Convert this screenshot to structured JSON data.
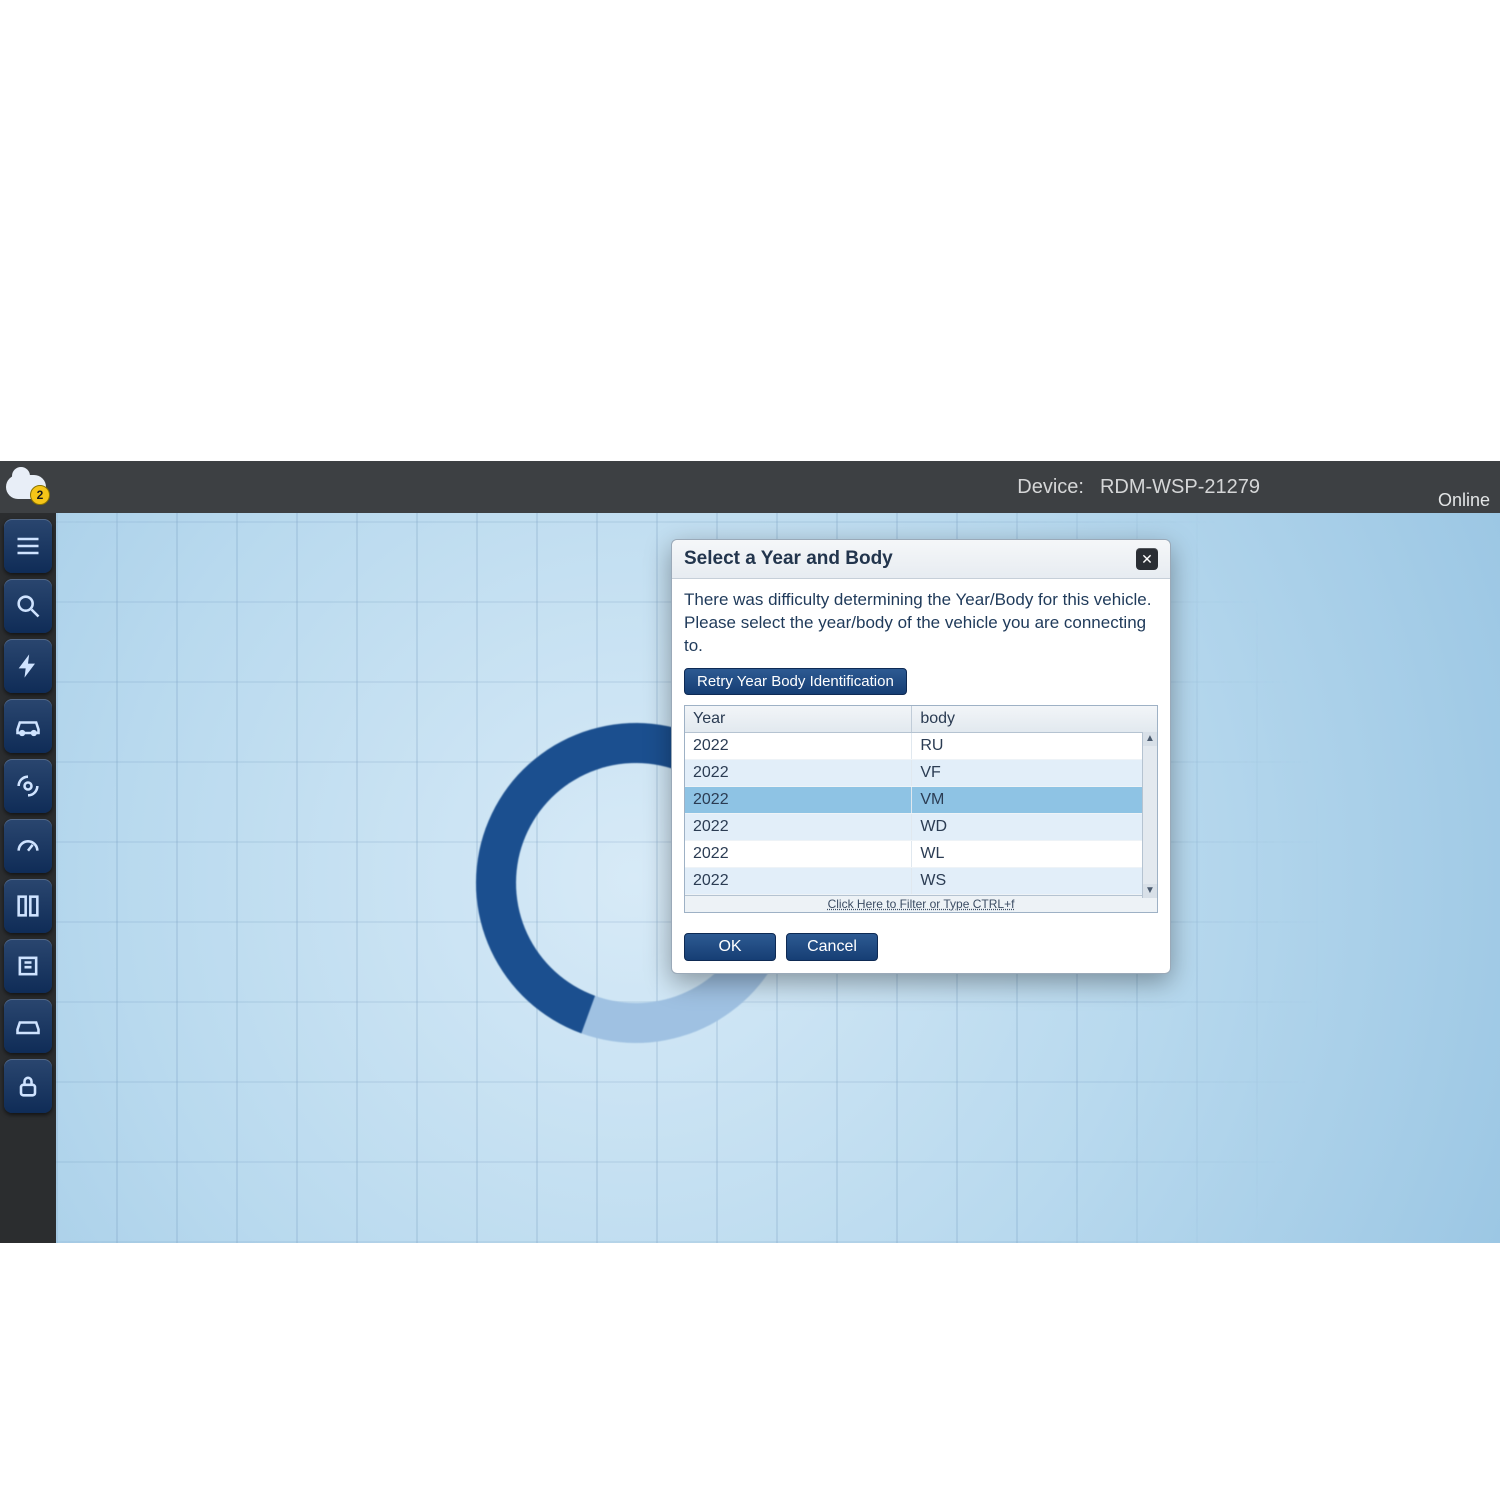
{
  "topbar": {
    "device_label": "Device:",
    "device_value": "RDM-WSP-21279",
    "online_label": "Online",
    "notification_count": "2"
  },
  "sidebar": {
    "items": [
      {
        "name": "menu"
      },
      {
        "name": "vehicle-search"
      },
      {
        "name": "flash"
      },
      {
        "name": "vehicle-view"
      },
      {
        "name": "systems-scan"
      },
      {
        "name": "misc-gauges"
      },
      {
        "name": "layout"
      },
      {
        "name": "vehicle-config"
      },
      {
        "name": "diag-2"
      },
      {
        "name": "lock"
      }
    ]
  },
  "dialog": {
    "title": "Select a Year and Body",
    "message": "There was difficulty determining the Year/Body for this vehicle. Please select the year/body of the vehicle you are connecting to.",
    "retry_label": "Retry Year Body Identification",
    "columns": {
      "year": "Year",
      "body": "body"
    },
    "rows": [
      {
        "year": "2022",
        "body": "RU",
        "selected": false
      },
      {
        "year": "2022",
        "body": "VF",
        "selected": false
      },
      {
        "year": "2022",
        "body": "VM",
        "selected": true
      },
      {
        "year": "2022",
        "body": "WD",
        "selected": false
      },
      {
        "year": "2022",
        "body": "WL",
        "selected": false
      },
      {
        "year": "2022",
        "body": "WS",
        "selected": false
      }
    ],
    "filter_hint": "Click Here to Filter or Type CTRL+f",
    "ok_label": "OK",
    "cancel_label": "Cancel"
  }
}
